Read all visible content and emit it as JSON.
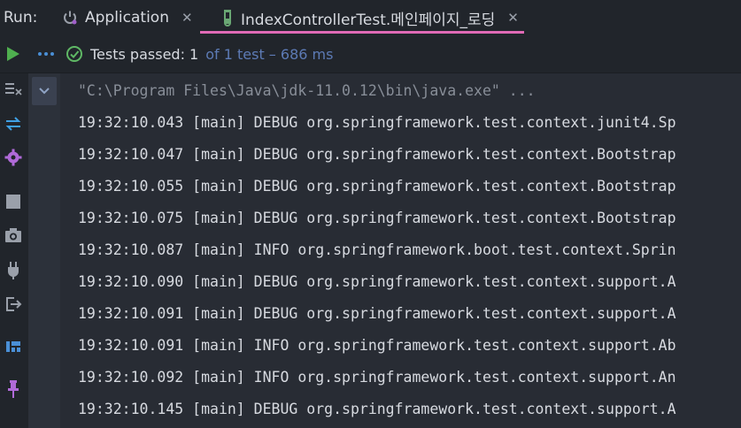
{
  "run_label": "Run:",
  "tabs": [
    {
      "label": "Application",
      "active": false
    },
    {
      "label": "IndexControllerTest.메인페이지_로딩",
      "active": true
    }
  ],
  "toolbar": {
    "status": "Tests passed: 1",
    "detail": "of 1 test – 686 ms"
  },
  "console": {
    "command": "\"C:\\Program Files\\Java\\jdk-11.0.12\\bin\\java.exe\" ...",
    "lines": [
      "19:32:10.043 [main] DEBUG org.springframework.test.context.junit4.Sp",
      "19:32:10.047 [main] DEBUG org.springframework.test.context.Bootstrap",
      "19:32:10.055 [main] DEBUG org.springframework.test.context.Bootstrap",
      "19:32:10.075 [main] DEBUG org.springframework.test.context.Bootstrap",
      "19:32:10.087 [main] INFO org.springframework.boot.test.context.Sprin",
      "19:32:10.090 [main] DEBUG org.springframework.test.context.support.A",
      "19:32:10.091 [main] DEBUG org.springframework.test.context.support.A",
      "19:32:10.091 [main] INFO org.springframework.test.context.support.Ab",
      "19:32:10.092 [main] INFO org.springframework.test.context.support.An",
      "19:32:10.145 [main] DEBUG org.springframework.test.context.support.A"
    ]
  },
  "colors": {
    "accent": "#e06ab6",
    "pass": "#5fb865",
    "play": "#4fb04f"
  }
}
